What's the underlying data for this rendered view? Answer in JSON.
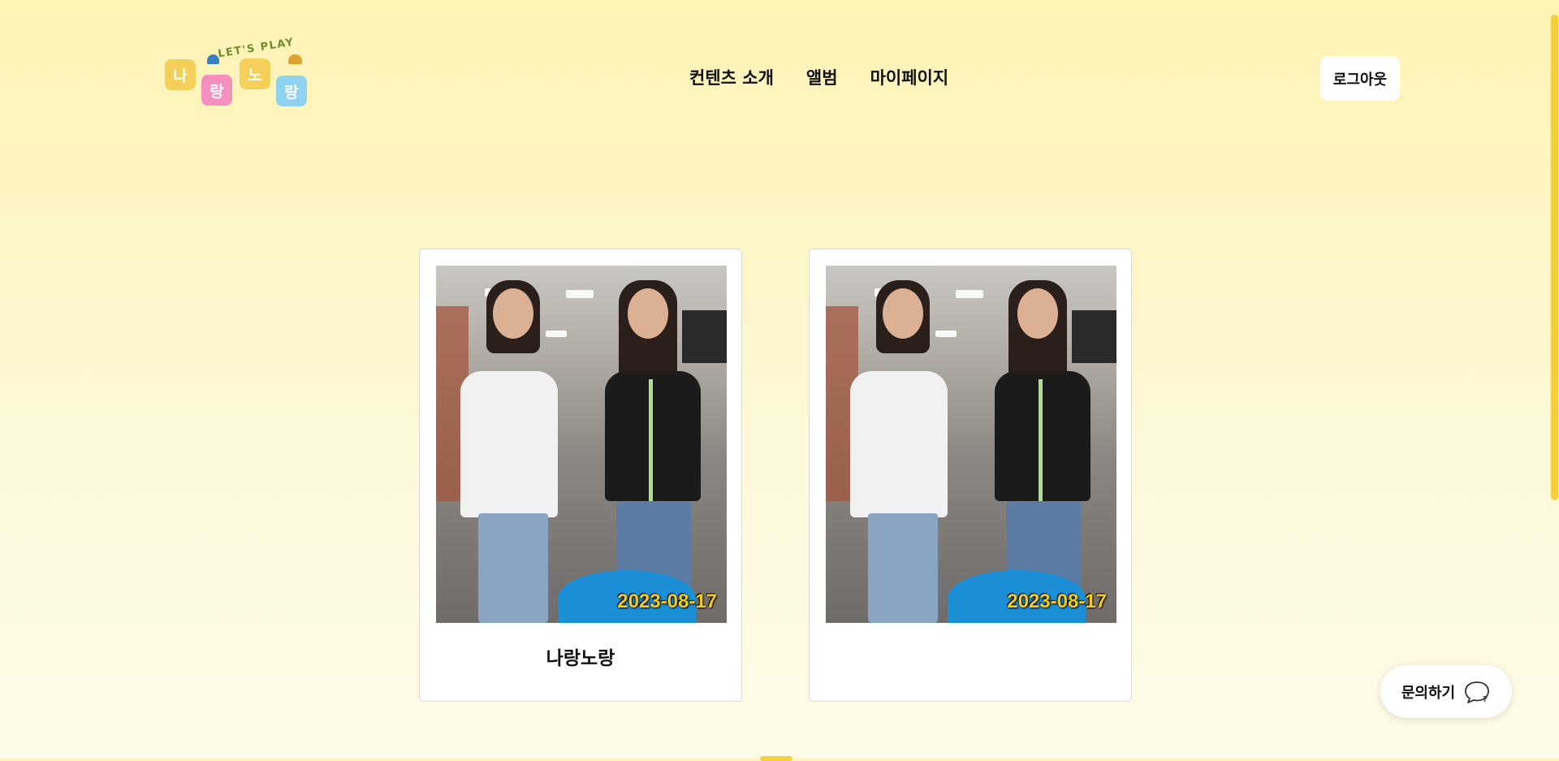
{
  "logo": {
    "tagline": "LET'S PLAY",
    "tiles": [
      "나",
      "랑",
      "노",
      "랑"
    ]
  },
  "nav": {
    "items": [
      {
        "label": "컨텐츠 소개"
      },
      {
        "label": "앨범"
      },
      {
        "label": "마이페이지"
      }
    ]
  },
  "header": {
    "logout_label": "로그아웃"
  },
  "album": {
    "cards": [
      {
        "date": "2023-08-17",
        "title": "나랑노랑"
      },
      {
        "date": "2023-08-17",
        "title": ""
      }
    ]
  },
  "inquiry": {
    "label": "문의하기"
  },
  "colors": {
    "accent_yellow": "#f5cf3d",
    "tile_pink": "#f58fbf",
    "tile_blue": "#8fd2f0",
    "date_stamp": "#f6c924"
  }
}
